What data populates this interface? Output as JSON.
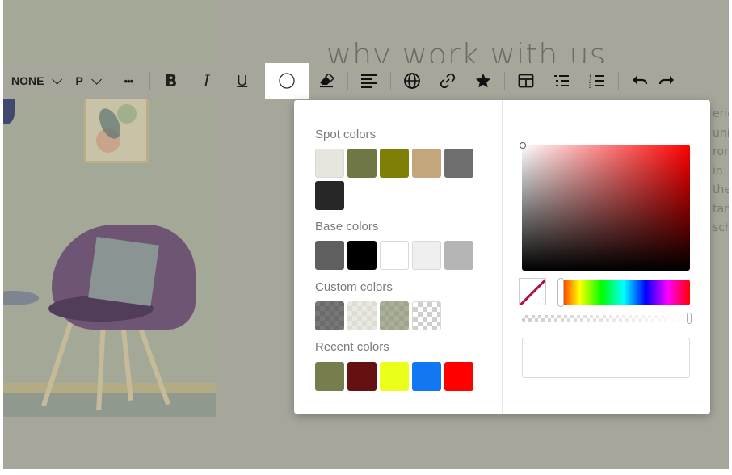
{
  "page": {
    "heading": "why work with us",
    "side_text": [
      "erie",
      "unic",
      "rom",
      "in",
      "the",
      "tan",
      "sch"
    ]
  },
  "toolbar": {
    "block_style": "NONE",
    "paragraph": "P",
    "more": "•••",
    "bold": "B",
    "italic": "I",
    "underline": "U"
  },
  "color_picker": {
    "spot_title": "Spot colors",
    "base_title": "Base colors",
    "custom_title": "Custom colors",
    "recent_title": "Recent colors",
    "spot_colors": [
      "#e6e6df",
      "#6f7845",
      "#7e8005",
      "#c4a67d",
      "#6e6e6e",
      "#272727"
    ],
    "base_colors": [
      "#5f5f5f",
      "#000000",
      "#ffffff",
      "#efefef",
      "#b5b5b5"
    ],
    "custom_colors": [
      "#4a4a4a",
      "#e2e2d8",
      "#8f9675",
      "#f2f2f2"
    ],
    "recent_colors": [
      "#777d4c",
      "#651111",
      "#eaff1a",
      "#1277f3",
      "#ff0000"
    ],
    "hue_color": "#ff0000",
    "hex_value": ""
  }
}
